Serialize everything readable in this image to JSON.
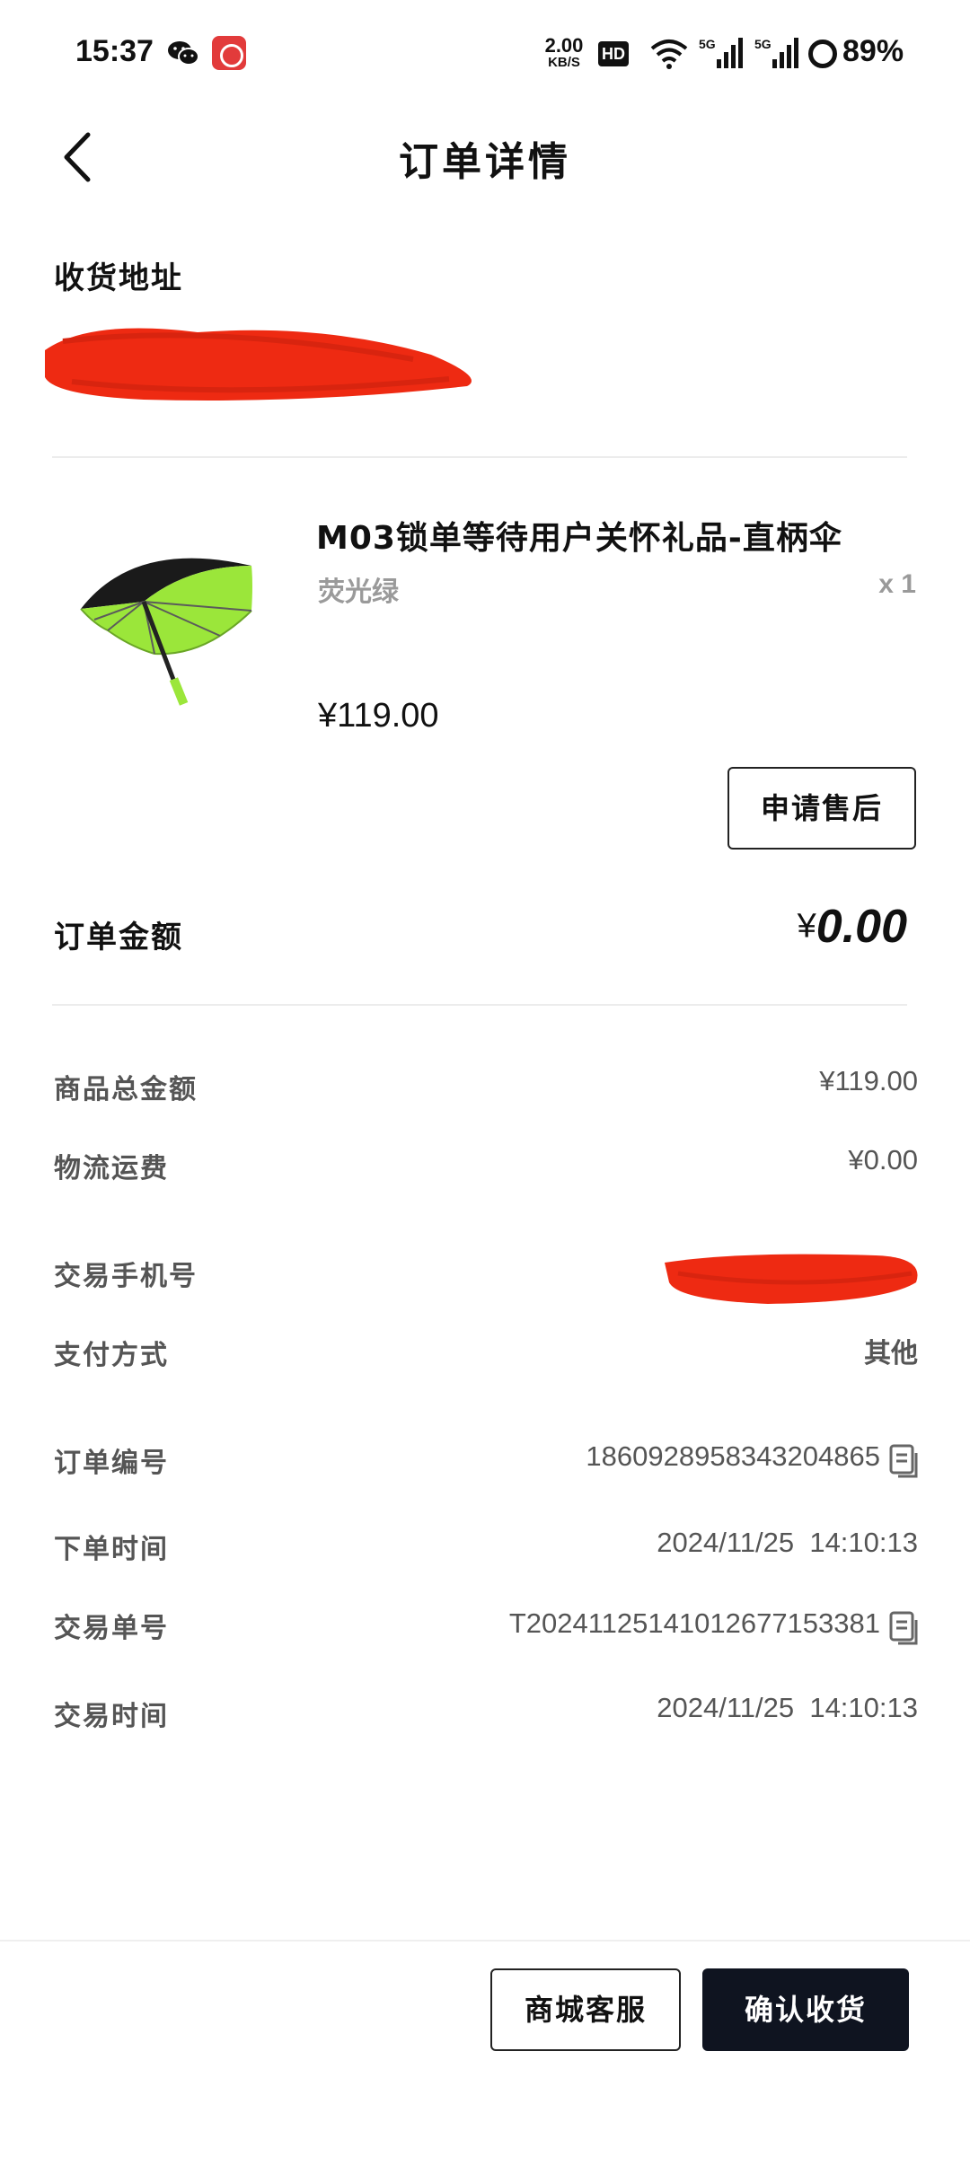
{
  "status_bar": {
    "time": "15:37",
    "net_speed_value": "2.00",
    "net_speed_unit": "KB/S",
    "hd_label": "HD",
    "sig1_label": "5G",
    "sig2_label": "5G",
    "battery": "89%"
  },
  "header": {
    "title": "订单详情"
  },
  "address": {
    "title": "收货地址"
  },
  "product": {
    "name": "M03锁单等待用户关怀礼品-直柄伞",
    "variant": "荧光绿",
    "quantity": "x 1",
    "price": "¥119.00",
    "after_sale_label": "申请售后"
  },
  "order_amount": {
    "label": "订单金额",
    "currency": "¥",
    "value": "0.00"
  },
  "details": {
    "goods_total_label": "商品总金额",
    "goods_total_value": "¥119.00",
    "shipping_label": "物流运费",
    "shipping_value": "¥0.00",
    "phone_label": "交易手机号",
    "payment_label": "支付方式",
    "payment_value": "其他",
    "order_no_label": "订单编号",
    "order_no_value": "1860928958343204865",
    "order_time_label": "下单时间",
    "order_time_value": "2024/11/25  14:10:13",
    "trade_no_label": "交易单号",
    "trade_no_value": "T20241125141012677153381",
    "trade_time_label": "交易时间",
    "trade_time_value": "2024/11/25  14:10:13"
  },
  "bottom_bar": {
    "service_label": "商城客服",
    "confirm_label": "确认收货"
  },
  "colors": {
    "redaction": "#ee2a12",
    "umbrella_green": "#9be63a",
    "primary_button": "#0f1420"
  }
}
